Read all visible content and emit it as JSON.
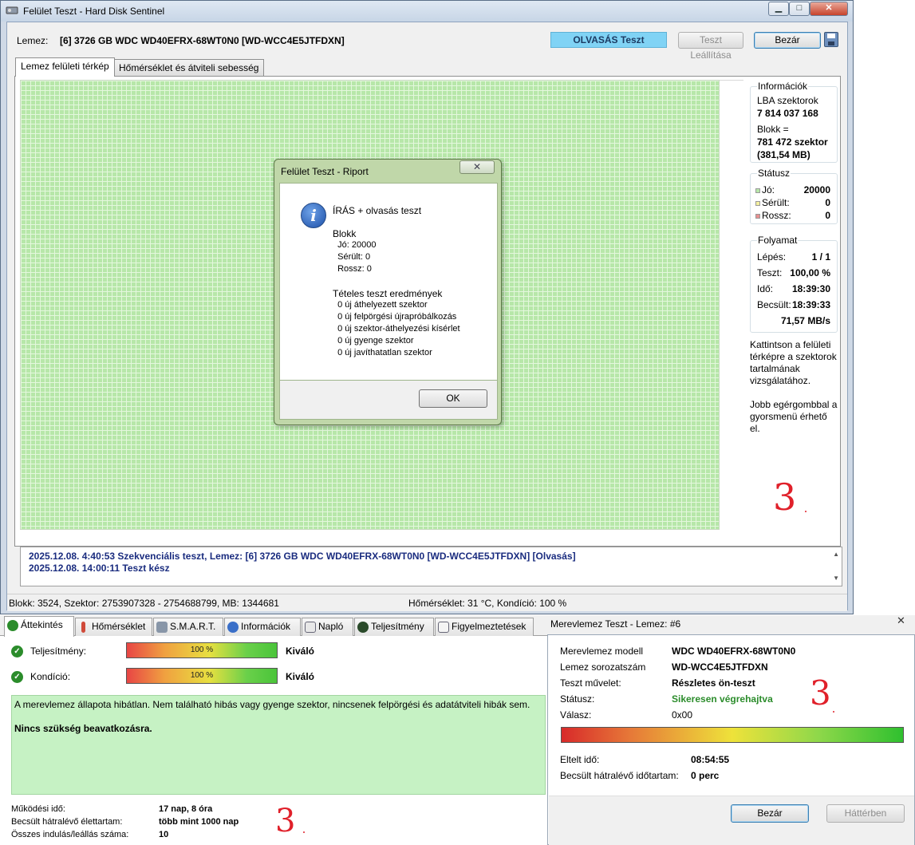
{
  "main_window": {
    "title": "Felület Teszt - Hard Disk Sentinel",
    "disk_label": "Lemez:",
    "disk_value": "[6] 3726 GB  WDC WD40EFRX-68WT0N0 [WD-WCC4E5JTFDXN]",
    "mode_badge": "OLVASÁS Teszt",
    "stop_button": "Teszt Leállítása",
    "close_button": "Bezár",
    "tabs": [
      "Lemez felületi térkép",
      "Hőmérséklet és átviteli sebesség"
    ]
  },
  "info_panel": {
    "title": "Információk",
    "lba_label": "LBA szektorok",
    "lba_value": "7 814 037 168",
    "block_label": "Blokk =",
    "block_value": "781 472 szektor",
    "block_size": "(381,54 MB)"
  },
  "status_panel": {
    "title": "Státusz",
    "good_label": "Jó:",
    "good_value": "20000",
    "damaged_label": "Sérült:",
    "damaged_value": "0",
    "bad_label": "Rossz:",
    "bad_value": "0"
  },
  "progress_panel": {
    "title": "Folyamat",
    "step_label": "Lépés:",
    "step_value": "1 / 1",
    "test_label": "Teszt:",
    "test_value": "100,00 %",
    "time_label": "Idő:",
    "time_value": "18:39:30",
    "est_label": "Becsült:",
    "est_value": "18:39:33",
    "speed": "71,57 MB/s"
  },
  "help_text": {
    "line1": "Kattintson a felületi",
    "line2": "térképre a szektorok",
    "line3": "tartalmának",
    "line4": "vizsgálatához.",
    "line5": "Jobb egérgombbal a",
    "line6": "gyorsmenü érhető",
    "line7": "el."
  },
  "log": [
    "2025.12.08.  4:40:53   Szekvenciális teszt, Lemez: [6] 3726 GB  WDC WD40EFRX-68WT0N0 [WD-WCC4E5JTFDXN] [Olvasás]",
    "2025.12.08.  14:00:11   Teszt kész"
  ],
  "status_bar": {
    "left": "Blokk: 3524, Szektor: 2753907328 - 2754688799, MB: 1344681",
    "right": "Hőmérséklet: 31  °C,  Kondíció: 100 %"
  },
  "report_dialog": {
    "title": "Felület Teszt - Riport",
    "heading": "ÍRÁS + olvasás teszt",
    "block_title": "Blokk",
    "good": "  Jó: 20000",
    "damaged": "  Sérült: 0",
    "bad": "  Rossz: 0",
    "batch_title": "Tételes teszt eredmények",
    "r1": "  0 új áthelyezett szektor",
    "r2": "  0 új felpörgési újrapróbálkozás",
    "r3": "  0 új szektor-áthelyezési kísérlet",
    "r4": "  0 új gyenge szektor",
    "r5": "  0 új javíthatatlan szektor",
    "ok_button": "OK"
  },
  "hds_panel": {
    "tabs": [
      "Áttekintés",
      "Hőmérséklet",
      "S.M.A.R.T.",
      "Információk",
      "Napló",
      "Teljesítmény",
      "Figyelmeztetések"
    ],
    "performance_label": "Teljesítmény:",
    "performance_value": "100 %",
    "performance_rating": "Kiváló",
    "condition_label": "Kondíció:",
    "condition_value": "100 %",
    "condition_rating": "Kiváló",
    "status_message": "A merevlemez állapota hibátlan. Nem található hibás vagy gyenge szektor, nincsenek felpörgési és adatátviteli hibák sem.",
    "action_message": "Nincs szükség beavatkozásra.",
    "uptime_label": "Működési idő:",
    "uptime_value": "17 nap, 8 óra",
    "lifetime_label": "Becsült hátralévő élettartam:",
    "lifetime_value": "több mint 1000 nap",
    "starts_label": "Összes indulás/leállás száma:",
    "starts_value": "10",
    "performance_pct": 100,
    "condition_pct": 100
  },
  "test_dialog": {
    "title": "Merevlemez Teszt - Lemez: #6",
    "model_label": "Merevlemez modell",
    "model_value": "WDC WD40EFRX-68WT0N0",
    "serial_label": "Lemez sorozatszám",
    "serial_value": "WD-WCC4E5JTFDXN",
    "op_label": "Teszt művelet:",
    "op_value": "Részletes ön-teszt",
    "status_label": "Státusz:",
    "status_value": "Sikeresen végrehajtva",
    "reply_label": "Válasz:",
    "reply_value": "0x00",
    "elapsed_label": "Eltelt idő:",
    "elapsed_value": "08:54:55",
    "remaining_label": "Becsült hátralévő időtartam:",
    "remaining_value": "0 perc",
    "close_button": "Bezár",
    "background_button": "Háttérben",
    "progress_pct": 100
  },
  "annotations": {
    "mark": "3"
  },
  "colors": {
    "badge": "#80d3f5",
    "grid_good": "#b7e7a9",
    "log_text": "#1a2c7f",
    "status_ok": "#2b8c2b",
    "report_bg": "#c0d7a9"
  }
}
